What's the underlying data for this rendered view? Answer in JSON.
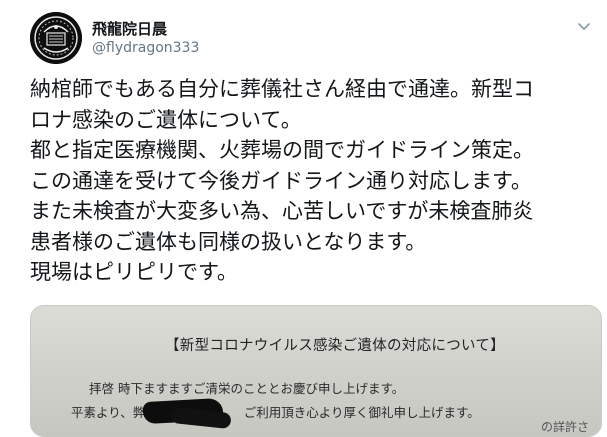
{
  "author": {
    "display_name": "飛龍院日晨",
    "handle": "@flydragon333",
    "avatar_icon": "ornate-emblem-avatar"
  },
  "menu_icon": "chevron-down-icon",
  "tweet_text_lines": [
    "納棺師でもある自分に葬儀社さん経由で通達。新型コ",
    "ロナ感染のご遺体について。",
    "都と指定医療機関、火葬場の間でガイドライン策定。",
    "この通達を受けて今後ガイドライン通り対応します。",
    "また未検査が大変多い為、心苦しいですが未検査肺炎",
    "患者様のご遺体も同様の扱いとなります。",
    "現場はピリピリです。"
  ],
  "attached_document": {
    "title": "【新型コロナウイルス感染ご遺体の対応について】",
    "line1": "拝啓 時下ますますご清栄のこととお慶び申し上げます。",
    "line2": "平素より、弊社",
    "line2_after_redaction": "ご利用頂き心より厚く御礼申し上げます。",
    "line2_right_fragment": "の詳許さ"
  },
  "colors": {
    "text": "#14171a",
    "secondary": "#657786"
  }
}
